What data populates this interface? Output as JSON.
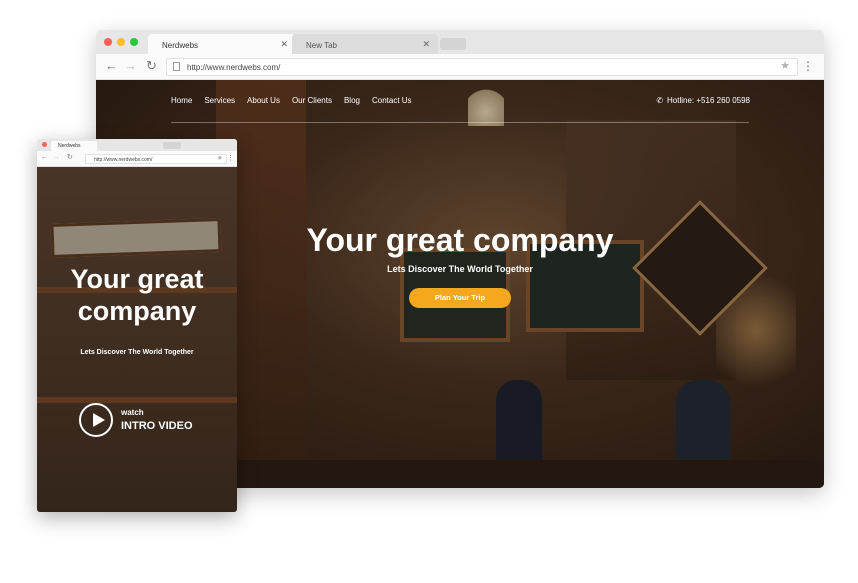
{
  "desktop": {
    "tabs": [
      {
        "label": "Nerdwebs",
        "active": true
      },
      {
        "label": "New Tab",
        "active": false
      }
    ],
    "window_buttons": [
      "#ff5f57",
      "#febc2e",
      "#28c840"
    ],
    "url": "http://www.nerdwebs.com/",
    "nav_items": [
      "Home",
      "Services",
      "About Us",
      "Our Clients",
      "Blog",
      "Contact Us"
    ],
    "hotline": "Hotline: +516 260 0598",
    "hero": {
      "title": "Your great company",
      "subtitle": "Lets Discover The World Together",
      "cta": "Plan Your Trip"
    },
    "accent_color": "#f4a81d"
  },
  "mobile": {
    "tab_label": "Nerdwebs",
    "url": "http://www.nerdwebs.com/",
    "hero": {
      "title": "Your great company",
      "subtitle": "Lets Discover The World Together",
      "watch_label": "watch",
      "intro_label": "INTRO VIDEO"
    }
  }
}
